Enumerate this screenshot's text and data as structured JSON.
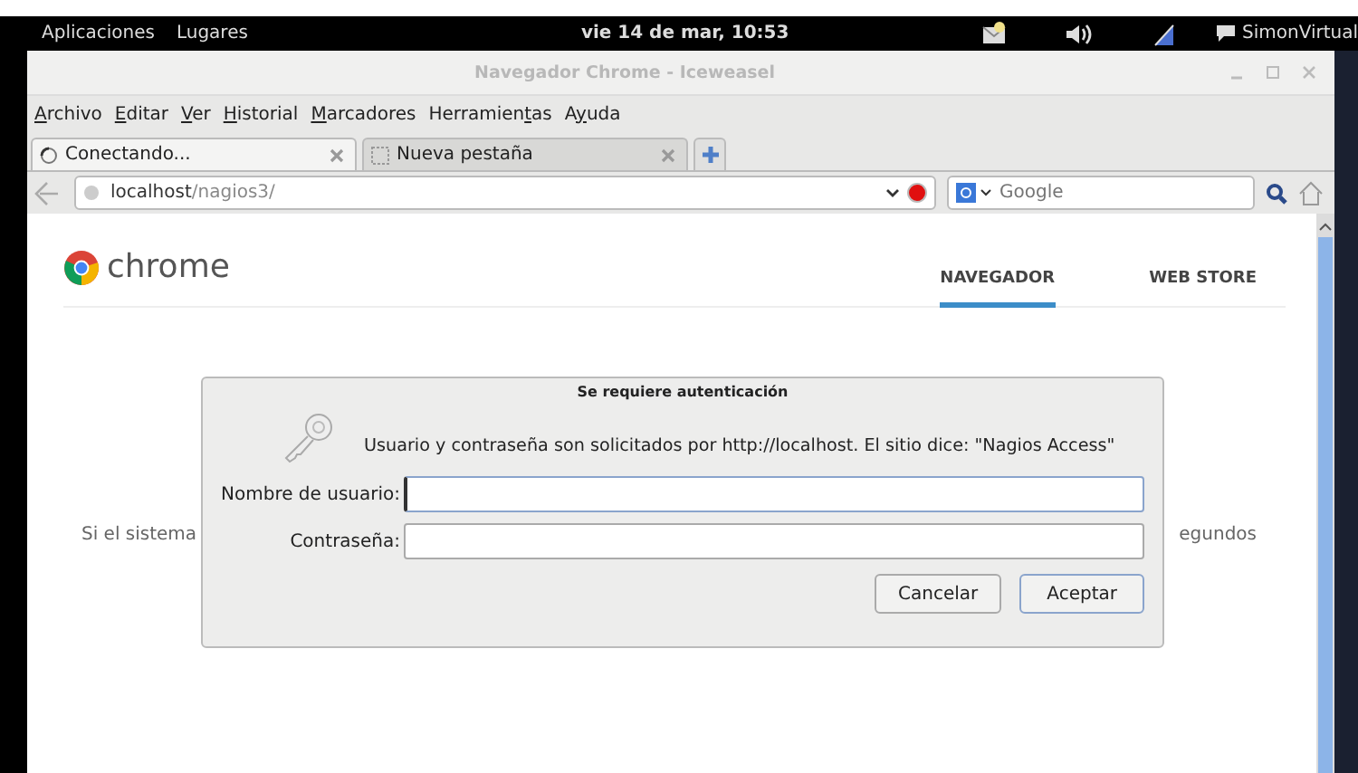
{
  "top_bar": {
    "menus": [
      "Aplicaciones",
      "Lugares"
    ],
    "clock": "vie 14 de mar, 10:53",
    "user": "SimonVirtual"
  },
  "window": {
    "title": "Navegador Chrome - Iceweasel"
  },
  "menu_bar": [
    {
      "key": "A",
      "after": "rchivo"
    },
    {
      "key": "E",
      "after": "ditar"
    },
    {
      "key": "V",
      "after": "er"
    },
    {
      "key": "H",
      "after": "istorial"
    },
    {
      "key": "M",
      "after": "arcadores"
    },
    {
      "before": "Herramien",
      "key": "t",
      "after": "as"
    },
    {
      "before": "A",
      "key": "y",
      "after": "uda"
    }
  ],
  "tabs": [
    {
      "label": "Conectando...",
      "selected": true,
      "kind": "loading"
    },
    {
      "label": "Nueva pestaña",
      "selected": false,
      "kind": "page"
    }
  ],
  "nav": {
    "url_host": "localhost",
    "url_path": "/nagios3/",
    "search_placeholder": "Google"
  },
  "page": {
    "brand": "chrome",
    "links": [
      {
        "label": "NAVEGADOR",
        "selected": true
      },
      {
        "label": "WEB STORE",
        "selected": false
      }
    ],
    "background_text": [
      "Si el sistema",
      "egundos"
    ]
  },
  "dialog": {
    "title": "Se requiere autenticación",
    "message": "Usuario y contraseña son solicitados por http://localhost. El sitio dice: \"Nagios Access\"",
    "fields": [
      {
        "label": "Nombre de usuario:",
        "focused": true
      },
      {
        "label": "Contraseña:",
        "focused": false
      }
    ],
    "buttons": [
      {
        "label": "Cancelar",
        "default": false
      },
      {
        "label": "Aceptar",
        "default": true
      }
    ]
  }
}
